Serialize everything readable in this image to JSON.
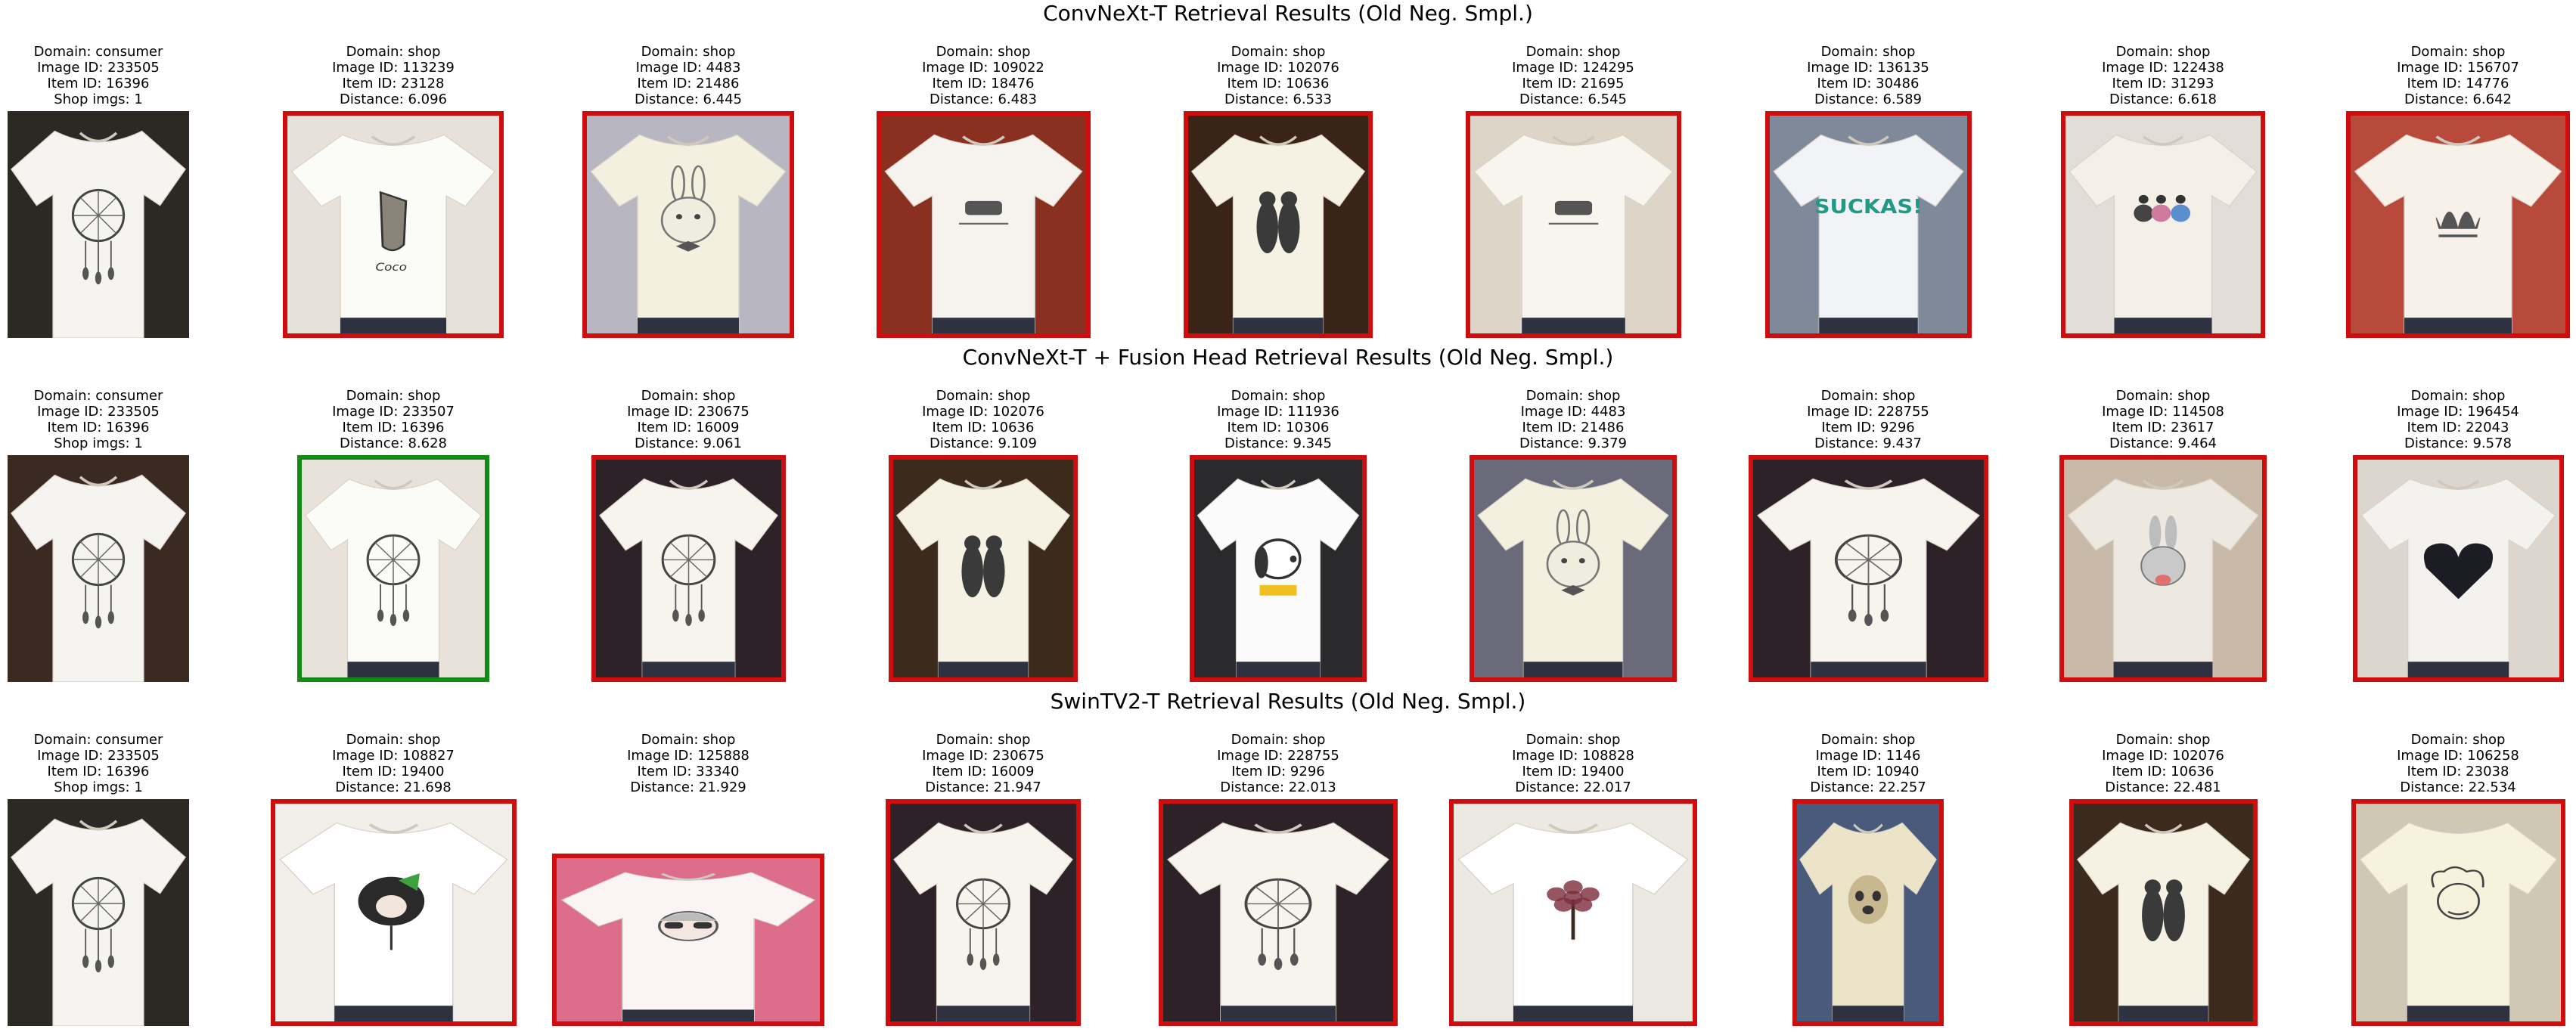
{
  "colors": {
    "incorrect_match_border": "#d10c0c",
    "correct_match_border": "#138a13"
  },
  "rows": [
    {
      "title": "ConvNeXt-T Retrieval Results (Old Neg. Smpl.)",
      "query": {
        "domain": "Domain: consumer",
        "image_id": "Image ID: 233505",
        "item_id": "Item ID: 16396",
        "shop_imgs": "Shop imgs: 1",
        "print": "dreamcatcher"
      },
      "results": [
        {
          "domain": "Domain: shop",
          "image_id": "Image ID: 113239",
          "item_id": "Item ID: 23128",
          "distance": "Distance: 6.096",
          "match": false,
          "print": "shoe"
        },
        {
          "domain": "Domain: shop",
          "image_id": "Image ID: 4483",
          "item_id": "Item ID: 21486",
          "distance": "Distance: 6.445",
          "match": false,
          "print": "rabbit"
        },
        {
          "domain": "Domain: shop",
          "image_id": "Image ID: 109022",
          "item_id": "Item ID: 18476",
          "distance": "Distance: 6.483",
          "match": false,
          "print": "small"
        },
        {
          "domain": "Domain: shop",
          "image_id": "Image ID: 102076",
          "item_id": "Item ID: 10636",
          "distance": "Distance: 6.533",
          "match": false,
          "print": "cats"
        },
        {
          "domain": "Domain: shop",
          "image_id": "Image ID: 124295",
          "item_id": "Item ID: 21695",
          "distance": "Distance: 6.545",
          "match": false,
          "print": "small"
        },
        {
          "domain": "Domain: shop",
          "image_id": "Image ID: 136135",
          "item_id": "Item ID: 30486",
          "distance": "Distance: 6.589",
          "match": false,
          "print": "sucks",
          "print_text": "SUCKAS!"
        },
        {
          "domain": "Domain: shop",
          "image_id": "Image ID: 122438",
          "item_id": "Item ID: 31293",
          "distance": "Distance: 6.618",
          "match": false,
          "print": "cartoon"
        },
        {
          "domain": "Domain: shop",
          "image_id": "Image ID: 156707",
          "item_id": "Item ID: 14776",
          "distance": "Distance: 6.642",
          "match": false,
          "print": "trefoil"
        }
      ]
    },
    {
      "title": "ConvNeXt-T + Fusion Head Retrieval Results (Old Neg. Smpl.)",
      "query": {
        "domain": "Domain: consumer",
        "image_id": "Image ID: 233505",
        "item_id": "Item ID: 16396",
        "shop_imgs": "Shop imgs: 1",
        "print": "dreamcatcher"
      },
      "results": [
        {
          "domain": "Domain: shop",
          "image_id": "Image ID: 233507",
          "item_id": "Item ID: 16396",
          "distance": "Distance: 8.628",
          "match": true,
          "print": "dreamcatcher"
        },
        {
          "domain": "Domain: shop",
          "image_id": "Image ID: 230675",
          "item_id": "Item ID: 16009",
          "distance": "Distance: 9.061",
          "match": false,
          "print": "dreamcatcher"
        },
        {
          "domain": "Domain: shop",
          "image_id": "Image ID: 102076",
          "item_id": "Item ID: 10636",
          "distance": "Distance: 9.109",
          "match": false,
          "print": "cats"
        },
        {
          "domain": "Domain: shop",
          "image_id": "Image ID: 111936",
          "item_id": "Item ID: 10306",
          "distance": "Distance: 9.345",
          "match": false,
          "print": "snoopy"
        },
        {
          "domain": "Domain: shop",
          "image_id": "Image ID: 4483",
          "item_id": "Item ID: 21486",
          "distance": "Distance: 9.379",
          "match": false,
          "print": "rabbit"
        },
        {
          "domain": "Domain: shop",
          "image_id": "Image ID: 228755",
          "item_id": "Item ID: 9296",
          "distance": "Distance: 9.437",
          "match": false,
          "print": "dreamcatcher"
        },
        {
          "domain": "Domain: shop",
          "image_id": "Image ID: 114508",
          "item_id": "Item ID: 23617",
          "distance": "Distance: 9.464",
          "match": false,
          "print": "bunny"
        },
        {
          "domain": "Domain: shop",
          "image_id": "Image ID: 196454",
          "item_id": "Item ID: 22043",
          "distance": "Distance: 9.578",
          "match": false,
          "print": "heart"
        }
      ]
    },
    {
      "title": "SwinTV2-T Retrieval Results (Old Neg. Smpl.)",
      "query": {
        "domain": "Domain: consumer",
        "image_id": "Image ID: 233505",
        "item_id": "Item ID: 16396",
        "shop_imgs": "Shop imgs: 1",
        "print": "dreamcatcher"
      },
      "results": [
        {
          "domain": "Domain: shop",
          "image_id": "Image ID: 108827",
          "item_id": "Item ID: 19400",
          "distance": "Distance: 21.698",
          "match": false,
          "print": "girl"
        },
        {
          "domain": "Domain: shop",
          "image_id": "Image ID: 125888",
          "item_id": "Item ID: 33340",
          "distance": "Distance: 21.929",
          "match": false,
          "print": "face"
        },
        {
          "domain": "Domain: shop",
          "image_id": "Image ID: 230675",
          "item_id": "Item ID: 16009",
          "distance": "Distance: 21.947",
          "match": false,
          "print": "dreamcatcher"
        },
        {
          "domain": "Domain: shop",
          "image_id": "Image ID: 228755",
          "item_id": "Item ID: 9296",
          "distance": "Distance: 22.013",
          "match": false,
          "print": "dreamcatcher"
        },
        {
          "domain": "Domain: shop",
          "image_id": "Image ID: 108828",
          "item_id": "Item ID: 19400",
          "distance": "Distance: 22.017",
          "match": false,
          "print": "tree"
        },
        {
          "domain": "Domain: shop",
          "image_id": "Image ID: 1146",
          "item_id": "Item ID: 10940",
          "distance": "Distance: 22.257",
          "match": false,
          "print": "pug"
        },
        {
          "domain": "Domain: shop",
          "image_id": "Image ID: 102076",
          "item_id": "Item ID: 10636",
          "distance": "Distance: 22.481",
          "match": false,
          "print": "cats"
        },
        {
          "domain": "Domain: shop",
          "image_id": "Image ID: 106258",
          "item_id": "Item ID: 23038",
          "distance": "Distance: 22.534",
          "match": false,
          "print": "einstein"
        }
      ]
    }
  ]
}
